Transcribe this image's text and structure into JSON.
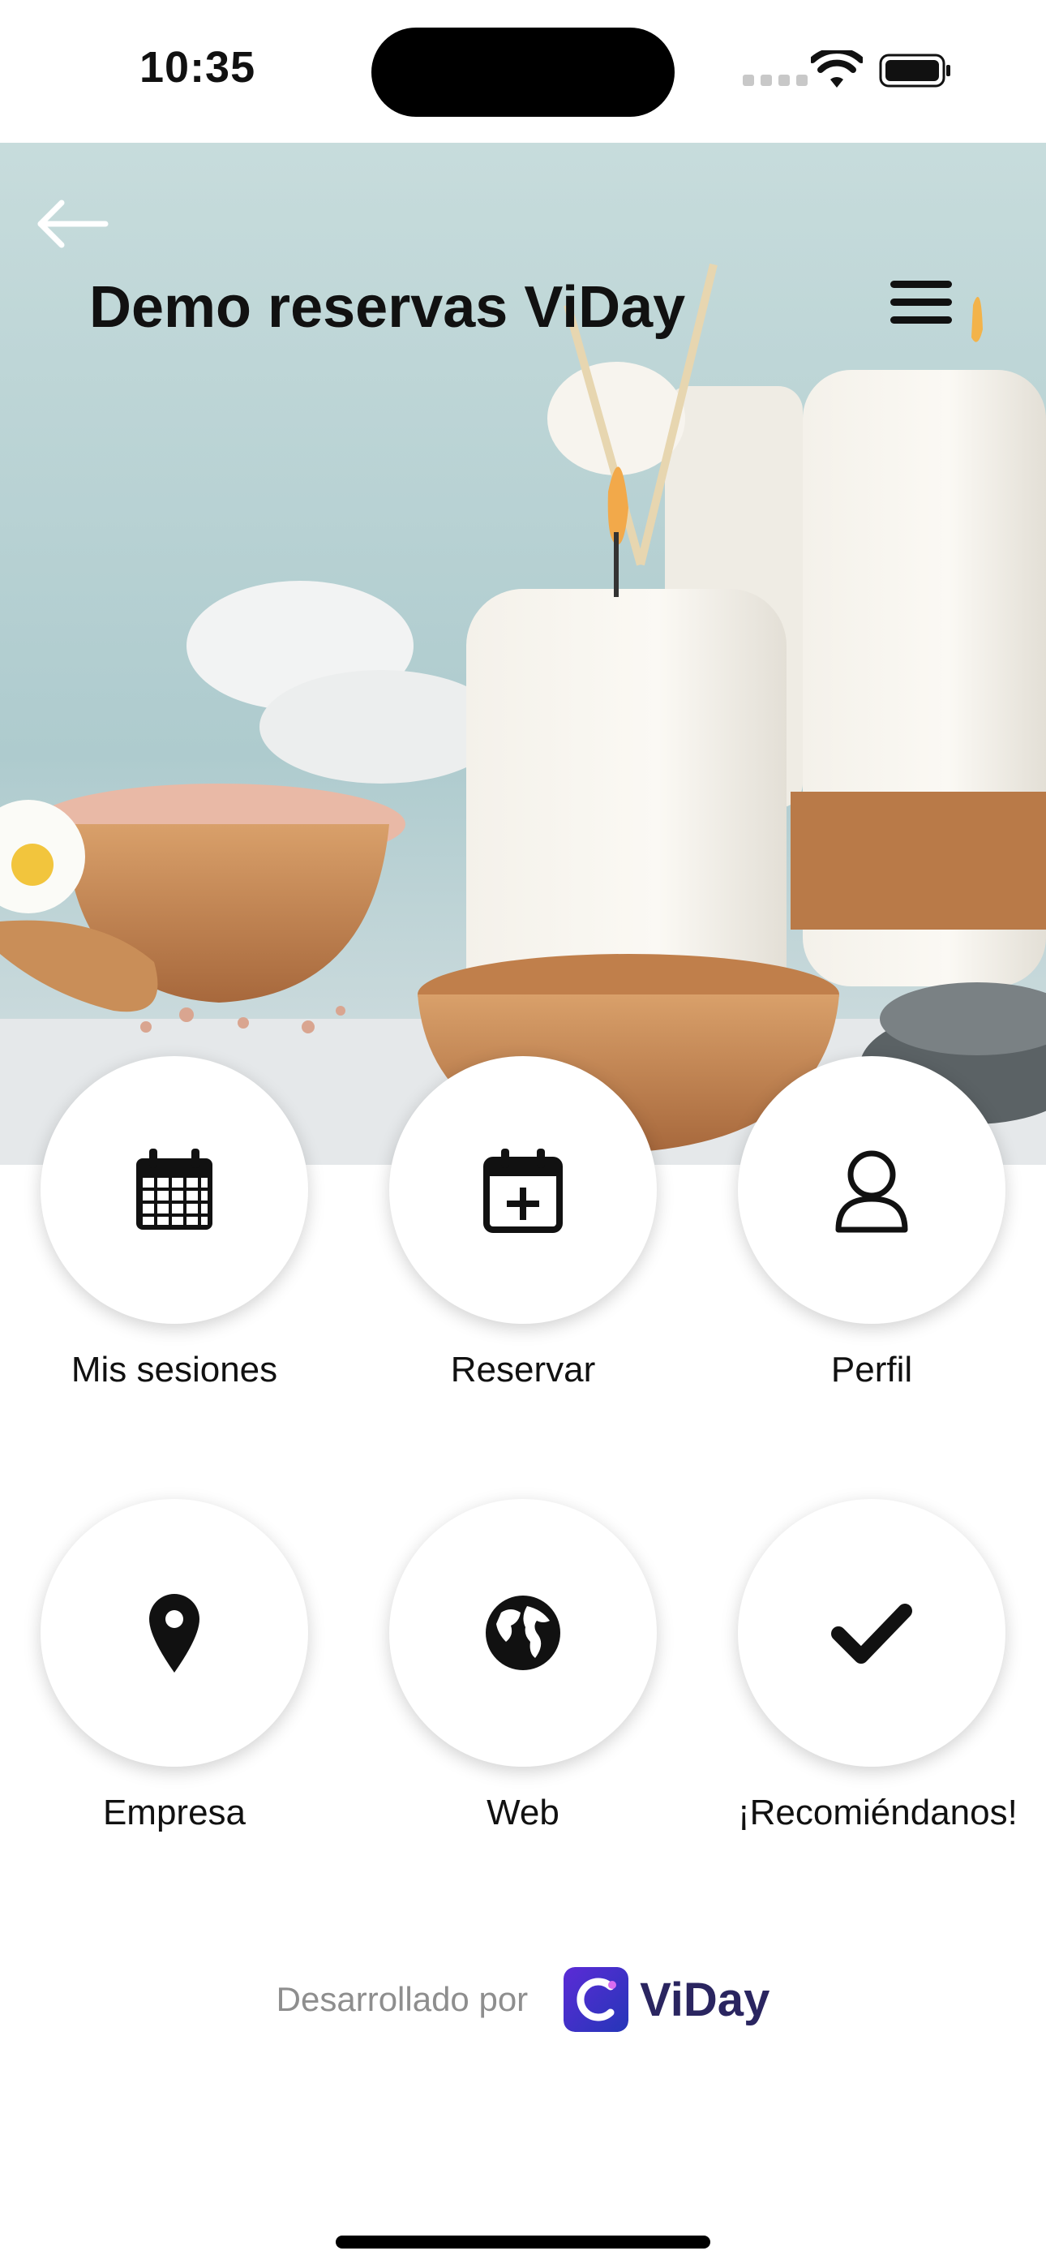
{
  "status_bar": {
    "time": "10:35"
  },
  "header": {
    "title": "Demo reservas ViDay"
  },
  "tiles": [
    {
      "label": "Mis sesiones",
      "icon": "calendar-grid-icon"
    },
    {
      "label": "Reservar",
      "icon": "calendar-plus-icon"
    },
    {
      "label": "Perfil",
      "icon": "user-icon"
    },
    {
      "label": "Empresa",
      "icon": "map-pin-icon"
    },
    {
      "label": "Web",
      "icon": "globe-icon"
    },
    {
      "label": "¡Recomiéndanos!",
      "icon": "check-icon"
    }
  ],
  "footer": {
    "developed_by": "Desarrollado por",
    "brand": "ViDay"
  },
  "colors": {
    "brand": "#2a2560",
    "brand_gradient_start": "#5b2bd6",
    "brand_gradient_end": "#2536b8"
  }
}
